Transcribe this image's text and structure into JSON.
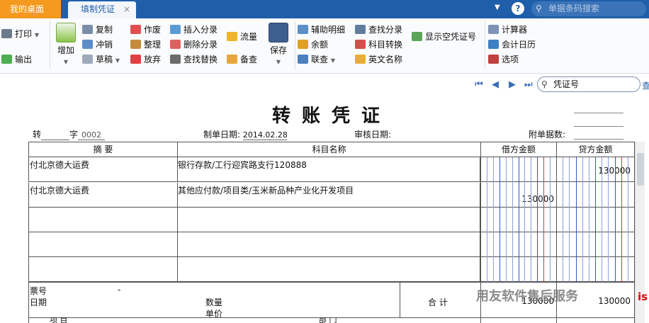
{
  "tabs": {
    "home": "我的桌面",
    "active": "填制凭证",
    "close": "×"
  },
  "barcode_search": {
    "placeholder": "单据条码搜索"
  },
  "toolbar": {
    "print": "打印",
    "export": "输出",
    "add": "增加",
    "copy": "复制",
    "reverse": "冲销",
    "draft": "草稿",
    "void": "作废",
    "tidy": "整理",
    "discard": "放弃",
    "insert_entry": "插入分录",
    "delete_entry": "删除分录",
    "find_replace": "查找替换",
    "flow": "流量",
    "memo": "备查",
    "save": "保存",
    "aux_detail": "辅助明细",
    "balance": "余额",
    "link": "联查",
    "find_entry": "查找分录",
    "subject_convert": "科目转换",
    "english_name": "英文名称",
    "show_empty_voucher": "显示空凭证号",
    "calculator": "计算器",
    "accounting_calendar": "会计日历",
    "options": "选项"
  },
  "voucher_search": {
    "value": "凭证号",
    "go": "查"
  },
  "voucher": {
    "title": "转账凭证",
    "type_char": "转",
    "word_label": "字",
    "number": "0002",
    "date_label": "制单日期:",
    "date": "2014.02.28",
    "audit_label": "审核日期:",
    "attach_label": "附单据数:",
    "headers": {
      "summary": "摘 要",
      "account": "科目名称",
      "debit": "借方金额",
      "credit": "贷方金额"
    },
    "rows": [
      {
        "summary": "付北京德大运费",
        "account": "银行存款/工行迎宾路支行120888",
        "debit": "",
        "credit": "130000"
      },
      {
        "summary": "付北京德大运费",
        "account": "其他应付款/项目类/玉米新品种产业化开发项目",
        "debit": "130000",
        "credit": ""
      },
      {
        "summary": "",
        "account": "",
        "debit": "",
        "credit": ""
      },
      {
        "summary": "",
        "account": "",
        "debit": "",
        "credit": ""
      },
      {
        "summary": "",
        "account": "",
        "debit": "",
        "credit": ""
      }
    ],
    "footer": {
      "ticket_no": "票号",
      "ticket_dash": "-",
      "date": "日期",
      "qty": "数量",
      "price": "单价",
      "total": "合 计",
      "total_debit": "130000",
      "total_credit": "130000",
      "project": "项 目",
      "dept": "部 门"
    }
  },
  "watermark": "用友软件售后服务"
}
